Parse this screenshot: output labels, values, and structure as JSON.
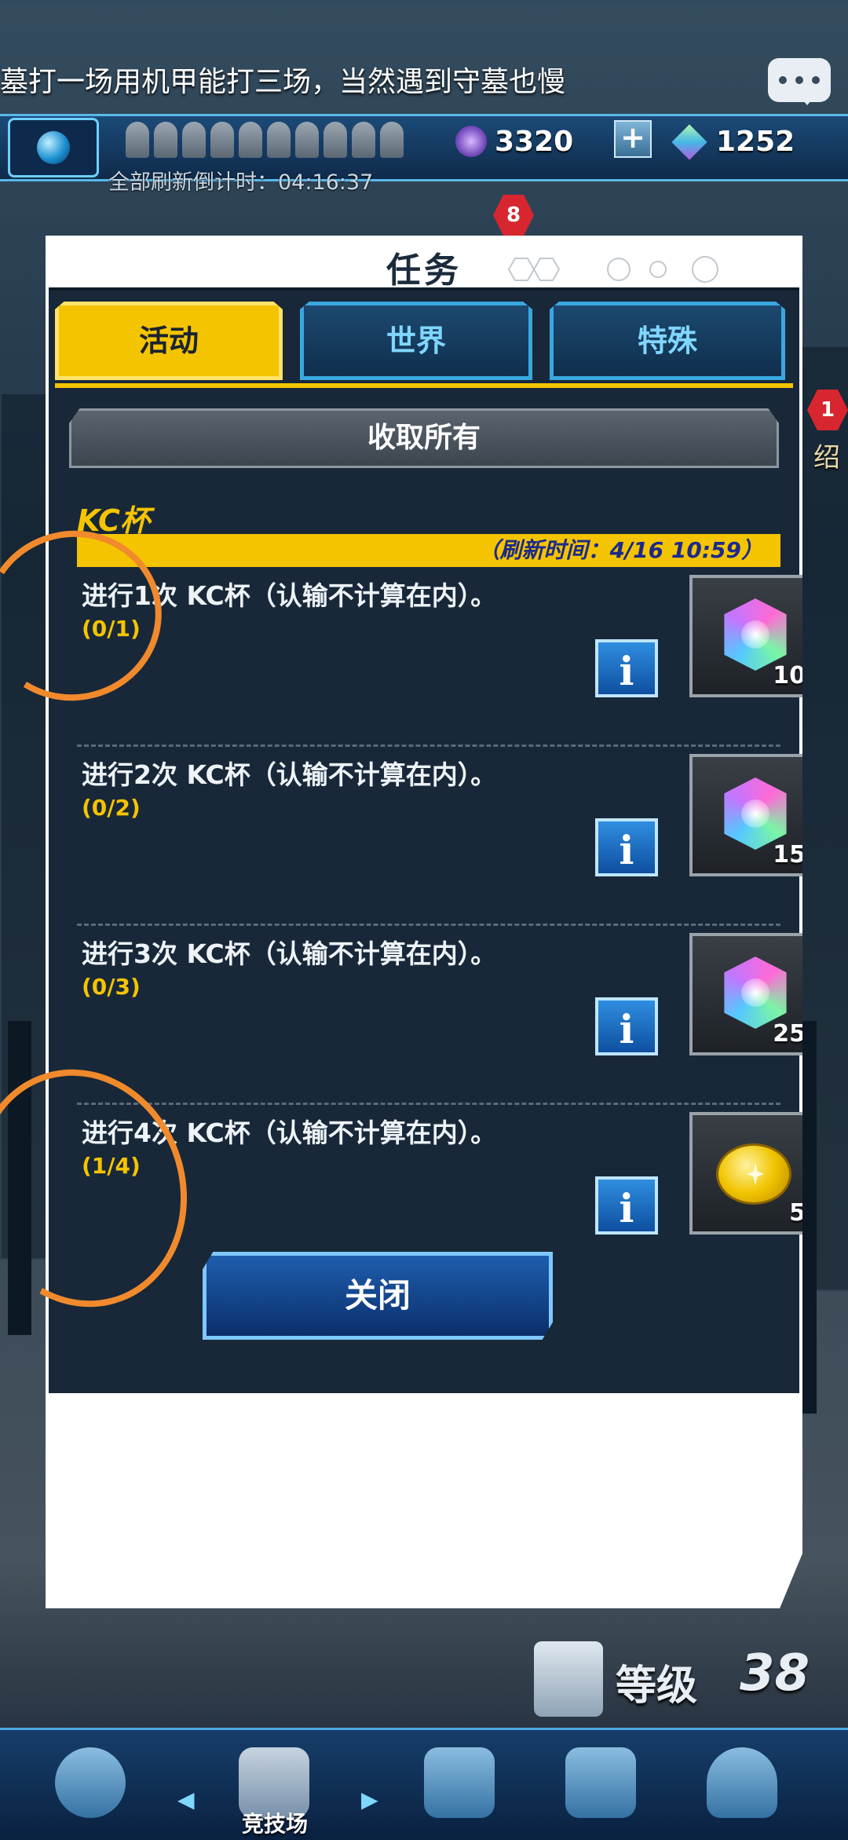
{
  "top_bar": {
    "ticker_text": "墓打一场用机甲能打三场，当然遇到守墓也慢",
    "currency_gem": "3320",
    "currency_crystal": "1252",
    "plus_label": "+",
    "refresh_countdown": "全部刷新倒计时：04:16:37",
    "badge_count": "8",
    "side_badge": "1",
    "side_label": "绍"
  },
  "dialog": {
    "title": "任务",
    "tabs": [
      {
        "label": "活动",
        "active": true
      },
      {
        "label": "世界",
        "active": false
      },
      {
        "label": "特殊",
        "active": false
      }
    ],
    "claim_all_label": "收取所有",
    "section_title": "KC杯",
    "refresh_time": "（刷新时间：4/16 10:59）",
    "info_label": "i",
    "tasks": [
      {
        "text": "进行1次 KC杯（认输不计算在内）。",
        "progress": "(0/1)",
        "reward_icon": "gem-icon",
        "reward_qty": "10"
      },
      {
        "text": "进行2次 KC杯（认输不计算在内）。",
        "progress": "(0/2)",
        "reward_icon": "gem-icon",
        "reward_qty": "15"
      },
      {
        "text": "进行3次 KC杯（认输不计算在内）。",
        "progress": "(0/3)",
        "reward_icon": "gem-icon",
        "reward_qty": "25"
      },
      {
        "text": "进行4次 KC杯（认输不计算在内）。",
        "progress": "(1/4)",
        "reward_icon": "coin-icon",
        "reward_qty": "5"
      }
    ],
    "close_label": "关闭"
  },
  "bottom": {
    "level_label": "等级",
    "level_value": "38",
    "nav": [
      {
        "icon": "gear-duelist-icon",
        "label": ""
      },
      {
        "icon": "crossed-swords-icon",
        "label": "竞技场"
      },
      {
        "icon": "shop-cart-icon",
        "label": ""
      },
      {
        "icon": "cards-icon",
        "label": ""
      },
      {
        "icon": "emblem-icon",
        "label": ""
      }
    ]
  },
  "colors": {
    "accent_yellow": "#f5c400",
    "panel_bg": "#182839",
    "tab_blue": "#3aa8e0",
    "annotation_orange": "#f08a2c"
  }
}
